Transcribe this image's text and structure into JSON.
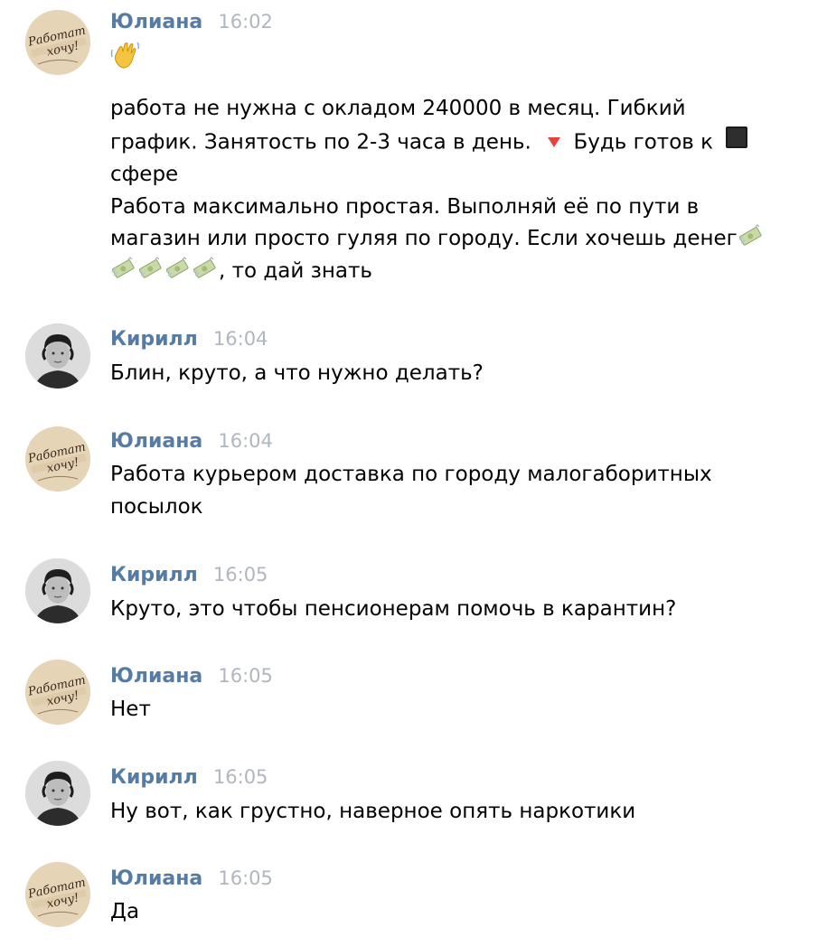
{
  "messages": [
    {
      "author": "Юлиана",
      "time": "16:02",
      "emoji": "wave",
      "paragraphs": [
        {
          "t1": "работа не нужна с окладом 240000 в месяц. Гибкий",
          "t2": "график. Занятость по 2-3 часа в день.",
          "t3": "Будь готов к",
          "t4": "сфере"
        },
        {
          "t1": "Работа максимально простая. Выполняй её по пути в",
          "t2": "магазин или просто гуляя по городу. Если хочешь денег",
          "t3": ", то дай знать"
        }
      ]
    },
    {
      "author": "Кирилл",
      "time": "16:04",
      "text": "Блин, круто, а что нужно делать?"
    },
    {
      "author": "Юлиана",
      "time": "16:04",
      "text1": "Работа курьером доставка по городу малогаборитных",
      "text2": "посылок"
    },
    {
      "author": "Кирилл",
      "time": "16:05",
      "text": "Круто, это чтобы пенсионерам помочь в карантин?"
    },
    {
      "author": "Юлиана",
      "time": "16:05",
      "text": "Нет"
    },
    {
      "author": "Кирилл",
      "time": "16:05",
      "text": "Ну вот, как грустно, наверное опять наркотики"
    },
    {
      "author": "Юлиана",
      "time": "16:05",
      "text": "Да"
    }
  ],
  "avatars": {
    "juliana_caption_line1": "Работат",
    "juliana_caption_line2": "хочу!"
  },
  "colors": {
    "author": "#567ca4",
    "time": "#b1b7be",
    "text": "#000000",
    "juliana_avatar_bg": "#e2cfb1"
  }
}
